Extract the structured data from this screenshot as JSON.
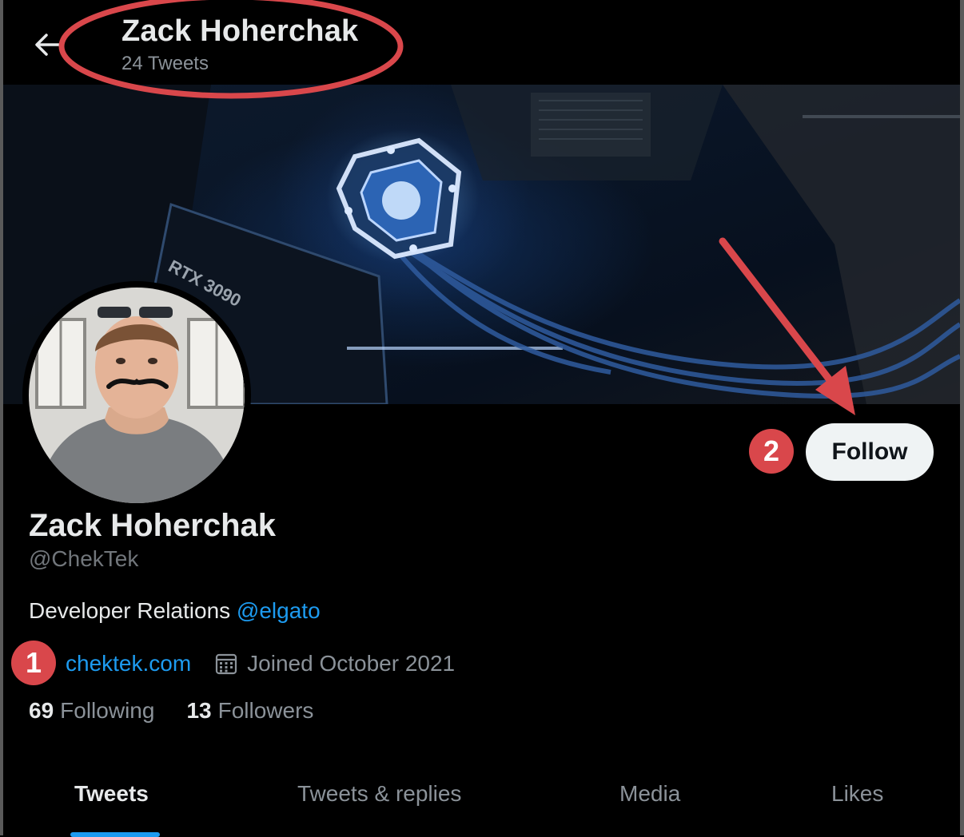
{
  "header": {
    "back_icon": "arrow-left-icon",
    "name": "Zack Hoherchak",
    "tweet_count": "24 Tweets"
  },
  "banner": {
    "gpu_label": "RTX 3090"
  },
  "profile": {
    "name": "Zack Hoherchak",
    "handle": "@ChekTek",
    "bio_text": "Developer Relations ",
    "bio_mention": "@elgato",
    "website": "chektek.com",
    "joined": "Joined October 2021",
    "following_count": "69",
    "following_label": "Following",
    "followers_count": "13",
    "followers_label": "Followers"
  },
  "actions": {
    "follow_label": "Follow"
  },
  "annotations": {
    "badge_1": "1",
    "badge_2": "2",
    "color": "#d9474b"
  },
  "tabs": [
    {
      "label": "Tweets",
      "active": true
    },
    {
      "label": "Tweets & replies",
      "active": false
    },
    {
      "label": "Media",
      "active": false
    },
    {
      "label": "Likes",
      "active": false
    }
  ],
  "colors": {
    "background": "#000000",
    "link": "#1d9bf0",
    "muted": "#8b9299",
    "follow_bg": "#eff3f4"
  }
}
